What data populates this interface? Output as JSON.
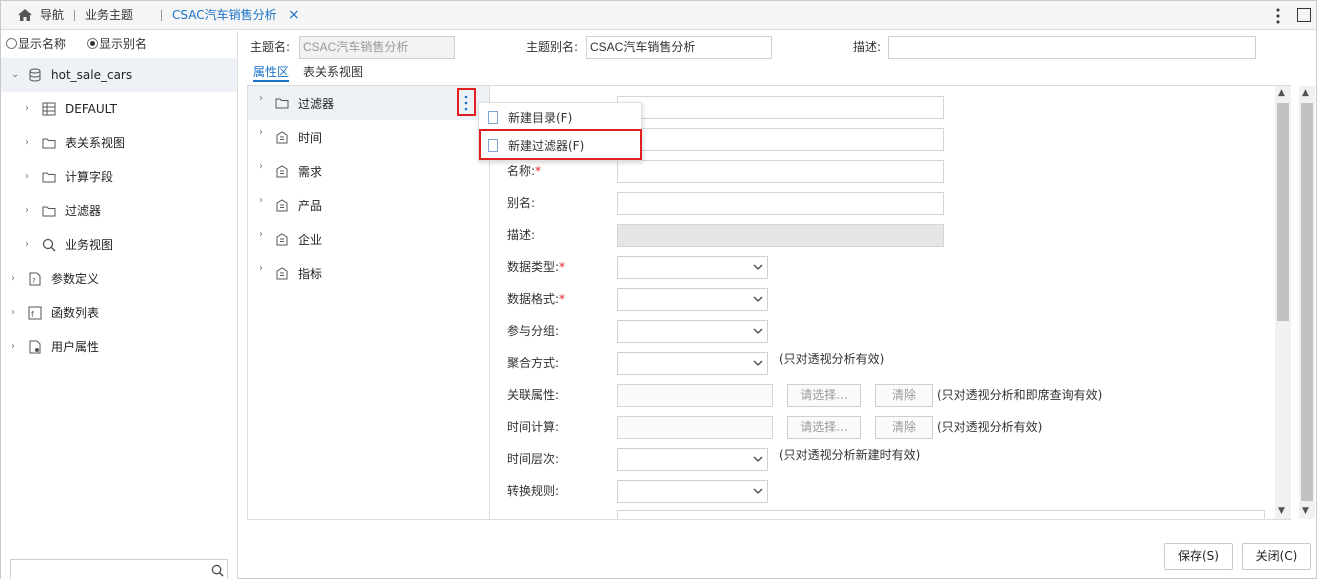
{
  "tabbar": {
    "home_label": "导航",
    "tab2_label": "业务主题",
    "tab3_label": "CSAC汽车销售分析",
    "close_glyph": "×"
  },
  "left": {
    "radio_name": "显示名称",
    "radio_alias": "显示别名",
    "tree": [
      {
        "label": "hot_sale_cars",
        "icon": "database-icon"
      },
      {
        "label": "DEFAULT",
        "icon": "table-icon"
      },
      {
        "label": "表关系视图",
        "icon": "folder-icon"
      },
      {
        "label": "计算字段",
        "icon": "folder-icon"
      },
      {
        "label": "过滤器",
        "icon": "folder-icon"
      },
      {
        "label": "业务视图",
        "icon": "search-icon"
      },
      {
        "label": "参数定义",
        "icon": "param-icon"
      },
      {
        "label": "函数列表",
        "icon": "function-icon"
      },
      {
        "label": "用户属性",
        "icon": "user-attr-icon"
      }
    ],
    "search_placeholder": ""
  },
  "header": {
    "topic_name_label": "主题名:",
    "topic_name_value": "CSAC汽车销售分析",
    "topic_alias_label": "主题别名:",
    "topic_alias_value": "CSAC汽车销售分析",
    "desc_label": "描述:",
    "desc_value": ""
  },
  "ptabs": {
    "attr": "属性区",
    "relation": "表关系视图"
  },
  "middle": {
    "items": [
      {
        "label": "过滤器",
        "icon": "folder-icon"
      },
      {
        "label": "时间",
        "icon": "building-icon"
      },
      {
        "label": "需求",
        "icon": "building-icon"
      },
      {
        "label": "产品",
        "icon": "building-icon"
      },
      {
        "label": "企业",
        "icon": "building-icon"
      },
      {
        "label": "指标",
        "icon": "building-icon"
      }
    ]
  },
  "context_menu": {
    "new_dir": "新建目录(F)",
    "new_filter": "新建过滤器(F)"
  },
  "form": {
    "name_label": "名称:",
    "alias_label": "别名:",
    "desc_label": "描述:",
    "data_type_label": "数据类型:",
    "data_format_label": "数据格式:",
    "group_label": "参与分组:",
    "agg_label": "聚合方式:",
    "agg_note": "(只对透视分析有效)",
    "rel_label": "关联属性:",
    "rel_note": "(只对透视分析和即席查询有效)",
    "time_calc_label": "时间计算:",
    "time_calc_note": "(只对透视分析有效)",
    "time_level_label": "时间层次:",
    "time_level_note": "(只对透视分析新建时有效)",
    "convert_label": "转换规则:",
    "choose_btn": "请选择...",
    "clear_btn": "清除",
    "required_mark": "*"
  },
  "buttons": {
    "save": "保存(S)",
    "close": "关闭(C)"
  }
}
